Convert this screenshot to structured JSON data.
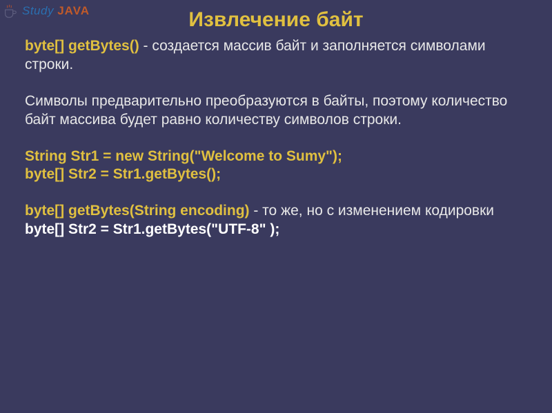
{
  "logo": {
    "study": "Study",
    "java": "JAVA"
  },
  "title": "Извлечение  байт",
  "p1": {
    "sig_type": "byte[] ",
    "sig_name": "getBytes",
    "sig_paren": "()",
    "desc": "  - создается массив байт и заполняется символами строки."
  },
  "p2": "Символы предварительно преобразуются в байты, поэтому количество байт массива будет равно количеству символов строки.",
  "code1": {
    "l1": "String Str1 = new String(\"Welcome to Sumy\");",
    "l2": "byte[] Str2 = Str1.getBytes();"
  },
  "p3": {
    "sig": "byte[] getBytes(String encoding)",
    "desc": " - то же, но с изменением кодировки"
  },
  "code2": {
    "l1": "byte[] Str2 = Str1.getBytes(\"UTF-8\" );"
  }
}
